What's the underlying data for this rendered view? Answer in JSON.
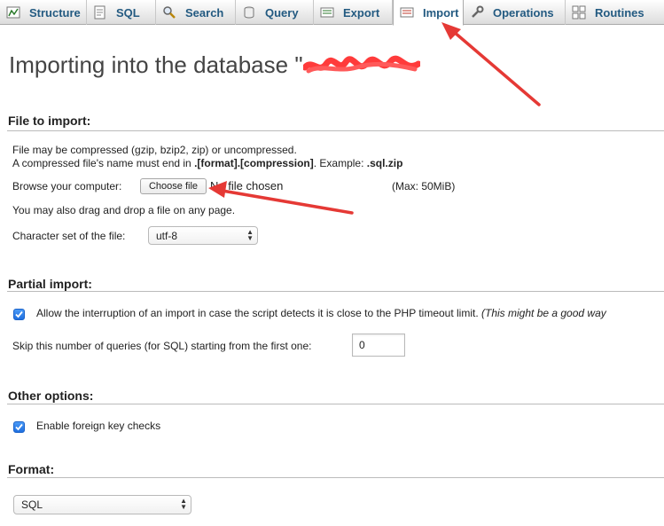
{
  "tabs": [
    {
      "label": "Structure",
      "icon": "structure-icon"
    },
    {
      "label": "SQL",
      "icon": "sql-icon"
    },
    {
      "label": "Search",
      "icon": "search-icon"
    },
    {
      "label": "Query",
      "icon": "query-icon"
    },
    {
      "label": "Export",
      "icon": "export-icon"
    },
    {
      "label": "Import",
      "icon": "import-icon",
      "active": true
    },
    {
      "label": "Operations",
      "icon": "operations-icon"
    },
    {
      "label": "Routines",
      "icon": "routines-icon"
    }
  ],
  "page": {
    "title": "Importing into the database \""
  },
  "file_to_import": {
    "heading": "File to import:",
    "line1": "File may be compressed (gzip, bzip2, zip) or uncompressed.",
    "line2_prefix": "A compressed file's name must end in ",
    "line2_bold": ".[format].[compression]",
    "line2_mid": ". Example: ",
    "line2_example": ".sql.zip",
    "browse_label": "Browse your computer:",
    "choose_file_button": "Choose file",
    "no_file_text": "No file chosen",
    "max_size": "(Max: 50MiB)",
    "drag_drop": "You may also drag and drop a file on any page.",
    "charset_label": "Character set of the file:",
    "charset_value": "utf-8"
  },
  "partial_import": {
    "heading": "Partial import:",
    "allow_interrupt_label": "Allow the interruption of an import in case the script detects it is close to the PHP timeout limit.",
    "allow_interrupt_note": "(This might be a good way",
    "allow_interrupt_checked": true,
    "skip_label": "Skip this number of queries (for SQL) starting from the first one:",
    "skip_value": "0"
  },
  "other_options": {
    "heading": "Other options:",
    "foreign_key_label": "Enable foreign key checks",
    "foreign_key_checked": true
  },
  "format": {
    "heading": "Format:",
    "value": "SQL"
  },
  "colors": {
    "tab_text": "#235a81",
    "annotation_red": "#e53935",
    "checkbox_blue": "#2b7de9"
  }
}
